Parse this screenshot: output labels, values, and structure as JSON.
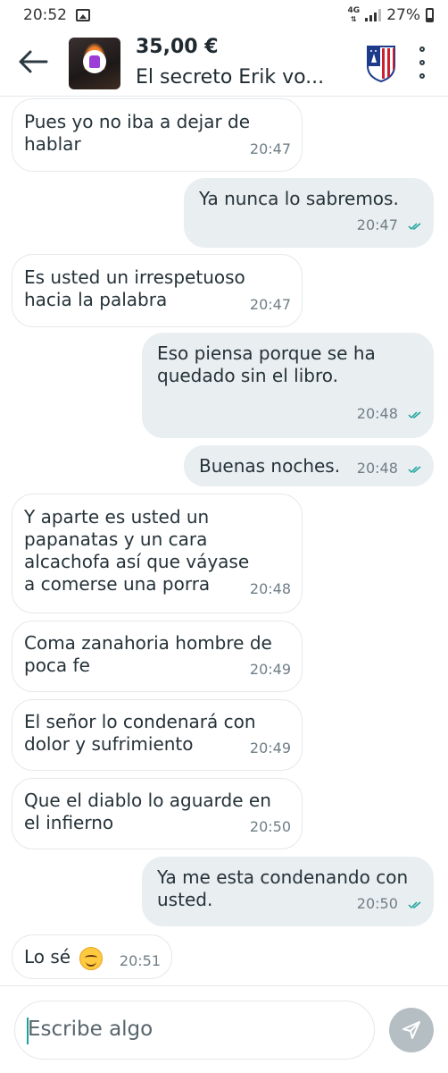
{
  "status_bar": {
    "time": "20:52",
    "network": "4G",
    "battery": "27%"
  },
  "header": {
    "price": "35,00 €",
    "title": "El secreto Erik vo..."
  },
  "messages": [
    {
      "dir": "in",
      "text": "Pues yo no iba a dejar de hablar",
      "time": "20:47"
    },
    {
      "dir": "out",
      "text": "Ya nunca lo sabremos.",
      "time": "20:47"
    },
    {
      "dir": "in",
      "text": "Es usted un irrespetuoso hacia la palabra",
      "time": "20:47"
    },
    {
      "dir": "out",
      "text": "Eso piensa porque se ha quedado sin el libro.",
      "time": "20:48"
    },
    {
      "dir": "out",
      "text": "Buenas noches.",
      "time": "20:48"
    },
    {
      "dir": "in",
      "text": "Y aparte es usted un papanatas y un cara alcachofa así que váyase a comerse una porra",
      "time": "20:48"
    },
    {
      "dir": "in",
      "text": "Coma zanahoria hombre de poca fe",
      "time": "20:49"
    },
    {
      "dir": "in",
      "text": "El señor lo condenará con dolor y sufrimiento",
      "time": "20:49"
    },
    {
      "dir": "in",
      "text": "Que el diablo lo aguarde en el infierno",
      "time": "20:50"
    },
    {
      "dir": "out",
      "text": "Ya me esta condenando con usted.",
      "time": "20:50"
    },
    {
      "dir": "in",
      "text": "Lo sé",
      "emoji": "smiling-face",
      "time": "20:51"
    }
  ],
  "composer": {
    "placeholder": "Escribe algo"
  },
  "icons": {
    "back": "arrow-left-icon",
    "more": "more-vertical-icon",
    "send": "send-icon",
    "read": "double-check-icon"
  },
  "colors": {
    "outgoing_bubble": "#e9eef1",
    "incoming_bubble": "#ffffff",
    "read_ticks": "#1aa39b",
    "send_button": "#b5bec3"
  }
}
